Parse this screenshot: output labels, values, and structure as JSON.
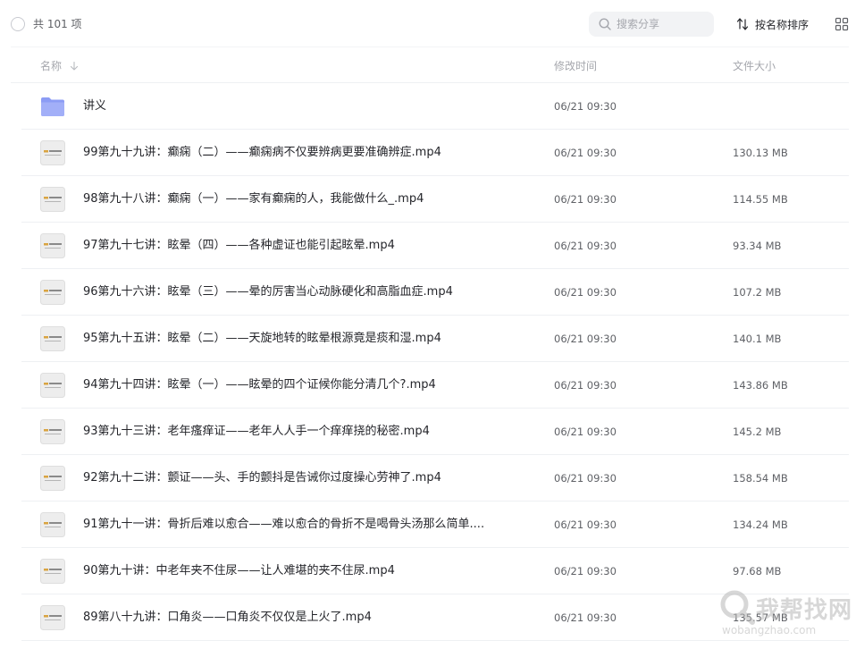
{
  "toolbar": {
    "total_count": "共 101 项",
    "search_placeholder": "搜索分享",
    "sort_label": "按名称排序"
  },
  "columns": {
    "name": "名称",
    "mtime": "修改时间",
    "size": "文件大小"
  },
  "files": [
    {
      "type": "folder",
      "name": "讲义",
      "mtime": "06/21 09:30",
      "size": ""
    },
    {
      "type": "video",
      "name": "99第九十九讲：癫痫（二）——癫痫病不仅要辨病更要准确辨症.mp4",
      "mtime": "06/21 09:30",
      "size": "130.13 MB"
    },
    {
      "type": "video",
      "name": "98第九十八讲：癫痫（一）——家有癫痫的人，我能做什么_.mp4",
      "mtime": "06/21 09:30",
      "size": "114.55 MB"
    },
    {
      "type": "video",
      "name": "97第九十七讲：眩晕（四）——各种虚证也能引起眩晕.mp4",
      "mtime": "06/21 09:30",
      "size": "93.34 MB"
    },
    {
      "type": "video",
      "name": "96第九十六讲：眩晕（三）——晕的厉害当心动脉硬化和高脂血症.mp4",
      "mtime": "06/21 09:30",
      "size": "107.2 MB"
    },
    {
      "type": "video",
      "name": "95第九十五讲：眩晕（二）——天旋地转的眩晕根源竟是痰和湿.mp4",
      "mtime": "06/21 09:30",
      "size": "140.1 MB"
    },
    {
      "type": "video",
      "name": "94第九十四讲：眩晕（一）——眩晕的四个证候你能分清几个?.mp4",
      "mtime": "06/21 09:30",
      "size": "143.86 MB"
    },
    {
      "type": "video",
      "name": "93第九十三讲：老年瘙痒证——老年人人手一个痒痒挠的秘密.mp4",
      "mtime": "06/21 09:30",
      "size": "145.2 MB"
    },
    {
      "type": "video",
      "name": "92第九十二讲：颤证——头、手的颤抖是告诫你过度操心劳神了.mp4",
      "mtime": "06/21 09:30",
      "size": "158.54 MB"
    },
    {
      "type": "video",
      "name": "91第九十一讲：骨折后难以愈合——难以愈合的骨折不是喝骨头汤那么简单....",
      "mtime": "06/21 09:30",
      "size": "134.24 MB"
    },
    {
      "type": "video",
      "name": "90第九十讲：中老年夹不住尿——让人难堪的夹不住尿.mp4",
      "mtime": "06/21 09:30",
      "size": "97.68 MB"
    },
    {
      "type": "video",
      "name": "89第八十九讲：口角炎——口角炎不仅仅是上火了.mp4",
      "mtime": "06/21 09:30",
      "size": "135.57 MB"
    }
  ],
  "icons": {
    "select_all": "circle-checkbox-icon",
    "search": "search-icon",
    "sort": "sort-icon",
    "view": "grid-view-icon",
    "folder": "folder-icon",
    "video": "video-thumbnail-icon"
  },
  "colors": {
    "folder": "#8c9cf5",
    "text_primary": "#25262b",
    "text_secondary": "#5f6166",
    "text_muted": "#a5a7ad",
    "divider": "#eef0f3",
    "search_bg": "#f2f3f5"
  },
  "watermark": {
    "title": "我帮找网",
    "url": "wobangzhao.com"
  }
}
